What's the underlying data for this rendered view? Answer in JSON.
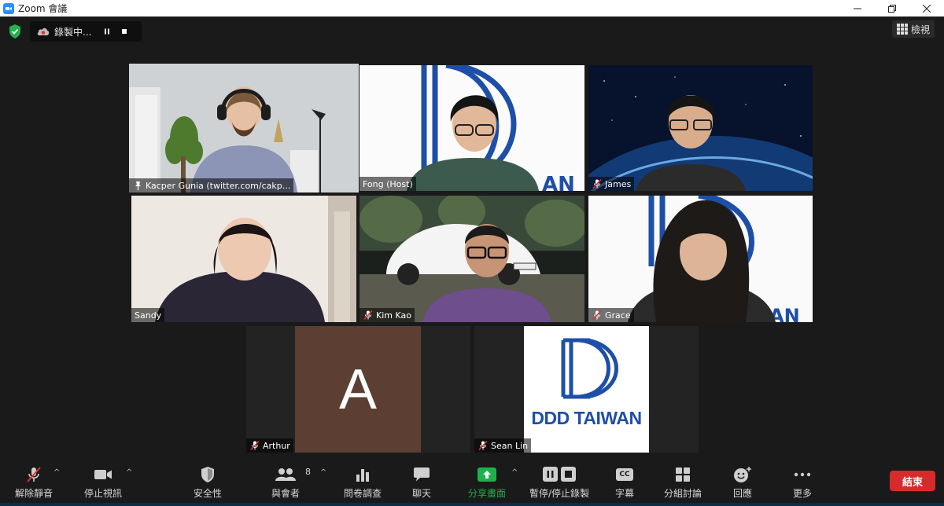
{
  "window": {
    "title": "Zoom 會議"
  },
  "recording": {
    "label": "錄製中..."
  },
  "view_button": {
    "label": "檢視"
  },
  "participants": [
    {
      "name": "Kacper Gunia (twitter.com/cakp...",
      "mic": "pin"
    },
    {
      "name": "Fong (Host)",
      "mic": "none"
    },
    {
      "name": "James",
      "mic": "muted"
    },
    {
      "name": "Sandy",
      "mic": "none"
    },
    {
      "name": "Kim Kao",
      "mic": "muted"
    },
    {
      "name": "Grace",
      "mic": "muted"
    },
    {
      "name": "Arthur",
      "mic": "muted",
      "avatar_letter": "A"
    },
    {
      "name": "Sean Lin",
      "mic": "muted",
      "logo_text": "DDD TAIWAN"
    }
  ],
  "toolbar": {
    "unmute": "解除靜音",
    "stop_video": "停止視訊",
    "security": "安全性",
    "participants": "與會者",
    "participants_count": "8",
    "polls": "問卷調查",
    "chat": "聊天",
    "share_screen": "分享畫面",
    "pause_stop_recording": "暫停/停止錄製",
    "captions": "字幕",
    "captions_icon": "CC",
    "breakout_rooms": "分組討論",
    "reactions": "回應",
    "more": "更多",
    "end": "結束"
  },
  "colors": {
    "accent_green": "#1fb04c",
    "end_red": "#d72b2b",
    "active_speaker": "#c6e06a",
    "ddd_blue": "#1e4fa8",
    "avatar_brown": "#5c3e33"
  }
}
